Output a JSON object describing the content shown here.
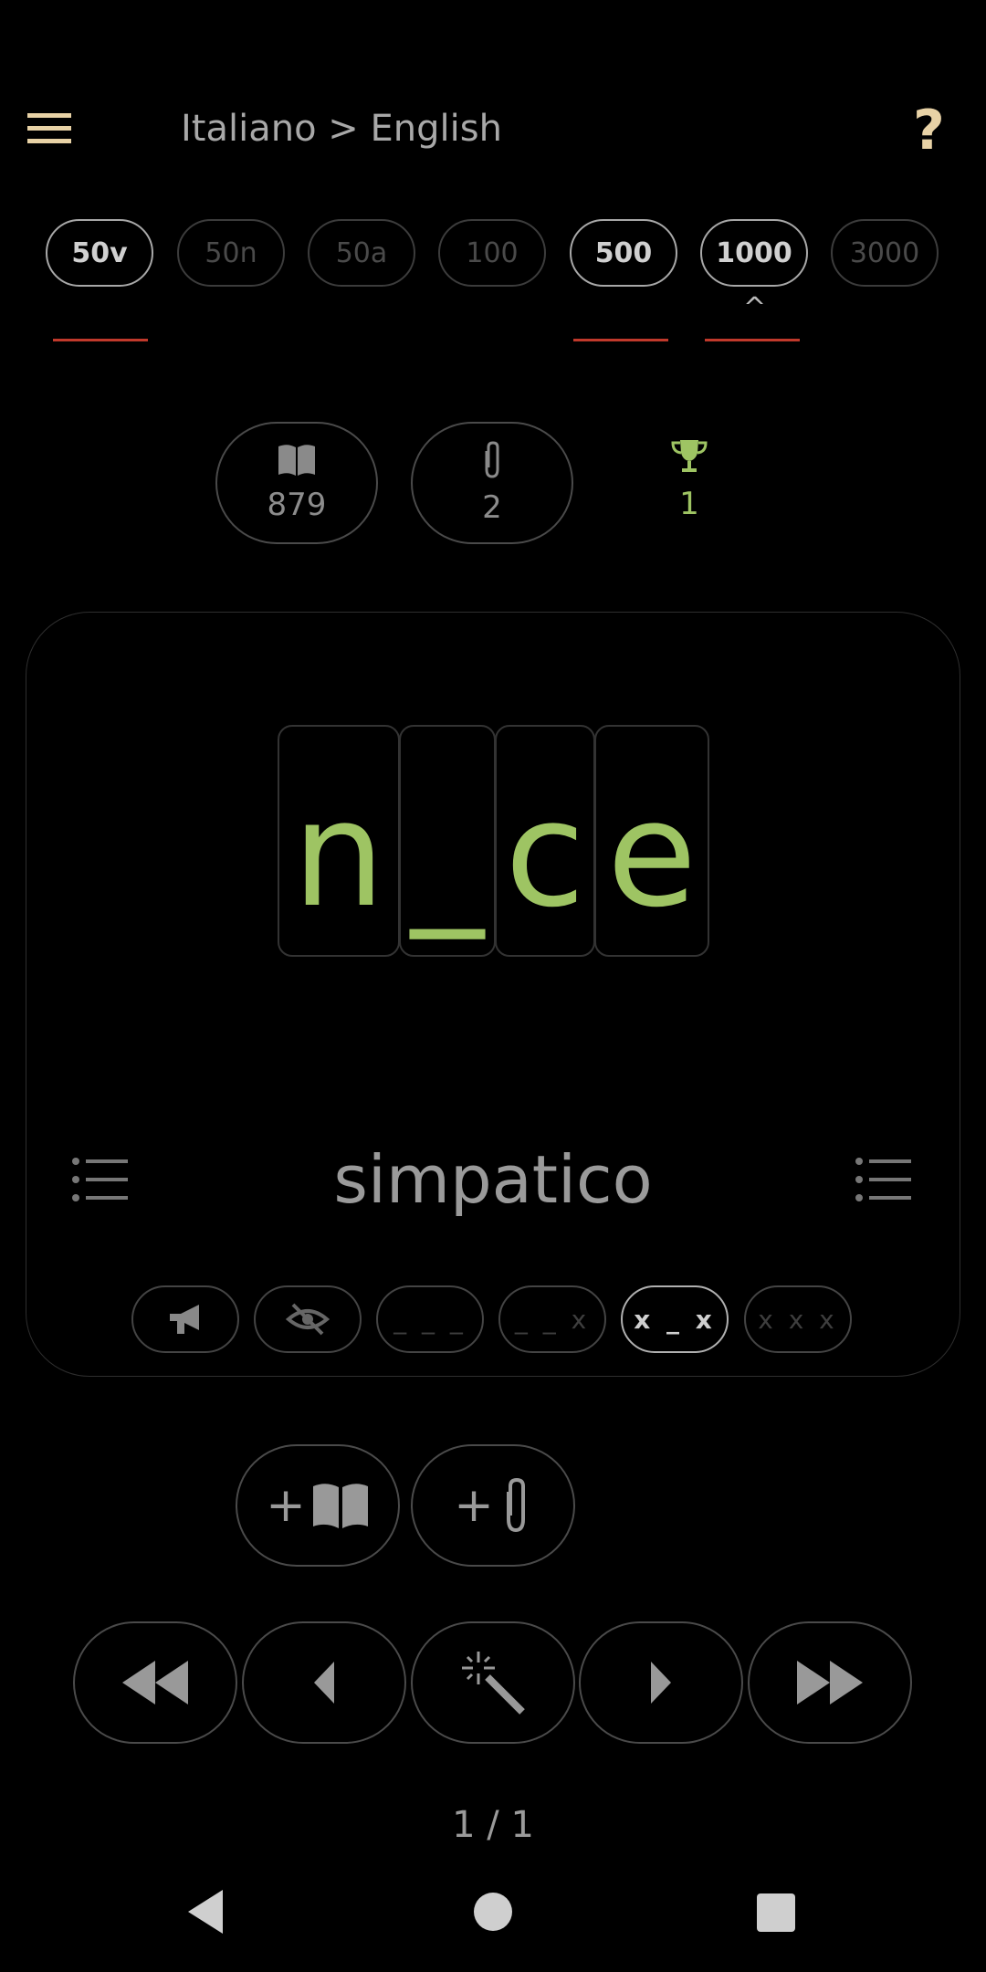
{
  "header": {
    "title": "Italiano > English",
    "help_label": "?"
  },
  "levels": [
    {
      "label": "50v",
      "active": true
    },
    {
      "label": "50n",
      "active": false
    },
    {
      "label": "50a",
      "active": false
    },
    {
      "label": "100",
      "active": false
    },
    {
      "label": "500",
      "active": true
    },
    {
      "label": "1000",
      "active": true
    },
    {
      "label": "3000",
      "active": false
    }
  ],
  "level_marker": "^",
  "stats": {
    "dictionary_count": "879",
    "clip_count": "2",
    "trophy_count": "1"
  },
  "card": {
    "letters": [
      "n",
      "_",
      "c",
      "e"
    ],
    "source_word": "simpatico",
    "modes": [
      {
        "label": "",
        "icon": "megaphone-icon"
      },
      {
        "label": "",
        "icon": "eye-off-icon"
      },
      {
        "label": "_ _ _"
      },
      {
        "label": "_ _ x"
      },
      {
        "label": "x _ x",
        "active": true
      },
      {
        "label": "x x x"
      }
    ]
  },
  "actions": {
    "add_dict": "+",
    "add_clip": "+"
  },
  "pager": "1 / 1",
  "colors": {
    "accent_green": "#9ec463",
    "accent_gold": "#e8d2a6",
    "marker_red": "#c0392b"
  }
}
